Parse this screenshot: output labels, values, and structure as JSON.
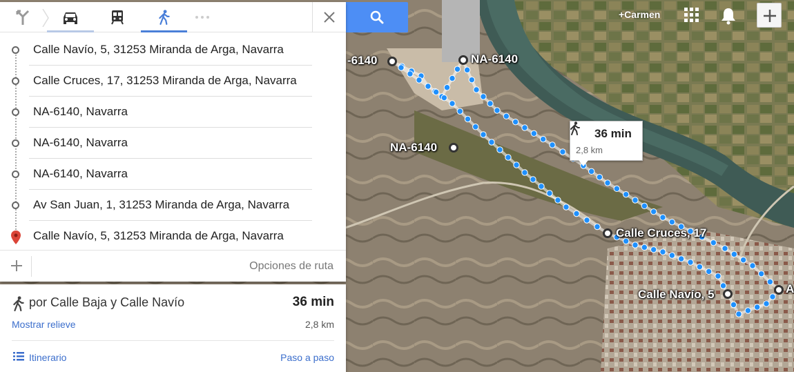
{
  "modes": {
    "directions_icon": "directions-icon",
    "car_icon": "car-icon",
    "transit_icon": "transit-icon",
    "walk_icon": "walk-icon",
    "more_icon": "more-icon",
    "close_icon": "close-icon",
    "selected": "walk"
  },
  "waypoints": [
    {
      "label": "Calle Navío, 5, 31253 Miranda de Arga, Navarra",
      "type": "stop"
    },
    {
      "label": "Calle Cruces, 17, 31253 Miranda de Arga, Navarra",
      "type": "stop"
    },
    {
      "label": "NA-6140, Navarra",
      "type": "stop"
    },
    {
      "label": "NA-6140, Navarra",
      "type": "stop"
    },
    {
      "label": "NA-6140, Navarra",
      "type": "stop"
    },
    {
      "label": "Av San Juan, 1, 31253 Miranda de Arga, Navarra",
      "type": "stop"
    },
    {
      "label": "Calle Navío, 5, 31253 Miranda de Arga, Navarra",
      "type": "destination"
    }
  ],
  "route_options": {
    "label": "Opciones de ruta",
    "add_icon": "add-icon"
  },
  "summary": {
    "via": "por Calle Baja y Calle Navío",
    "duration": "36 min",
    "relief_link": "Mostrar relieve",
    "distance": "2,8 km",
    "itinerary_link": "Itinerario",
    "step_link": "Paso a paso"
  },
  "account": {
    "name": "+Carmen"
  },
  "map": {
    "labels": {
      "na6140_left": "-6140",
      "na6140_top": "NA-6140",
      "na6140_mid": "NA-6140",
      "calle_cruces": "Calle Cruces, 17",
      "calle_navio": "Calle Navío, 5",
      "edge_a": "A"
    },
    "tooltip": {
      "duration": "36 min",
      "distance": "2,8 km"
    }
  },
  "colors": {
    "accent_blue": "#4d8ef5",
    "route_blue": "#1e90ff",
    "link_blue": "#3b6ecc",
    "pin_red": "#db4437"
  }
}
